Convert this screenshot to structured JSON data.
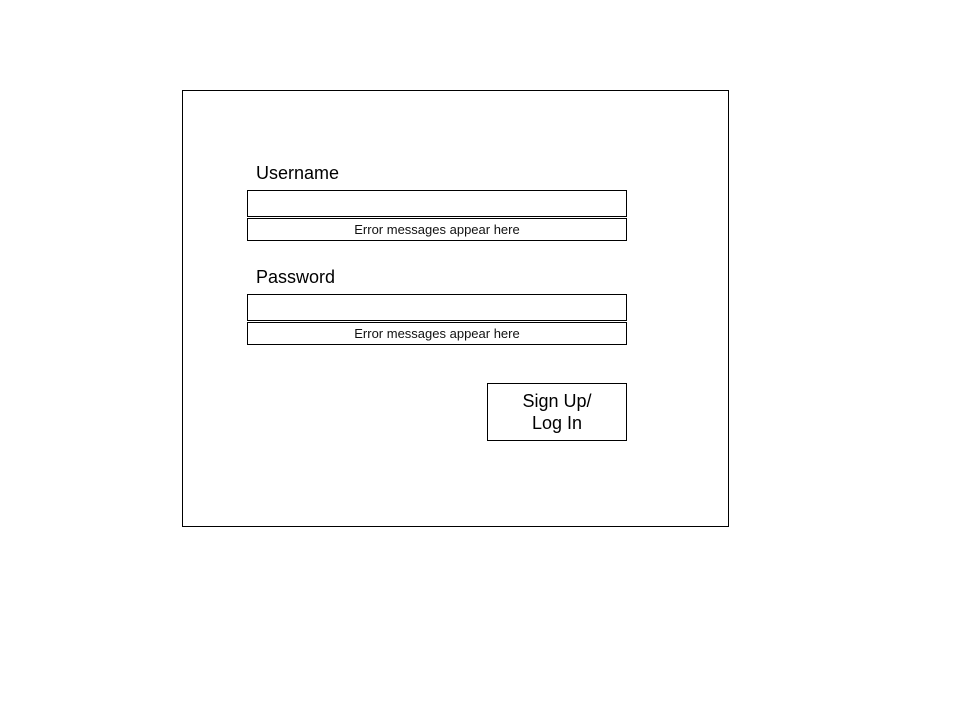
{
  "form": {
    "username_label": "Username",
    "username_value": "",
    "username_error": "Error messages appear here",
    "password_label": "Password",
    "password_value": "",
    "password_error": "Error messages appear here",
    "submit_line1": "Sign Up/",
    "submit_line2": "Log In"
  }
}
